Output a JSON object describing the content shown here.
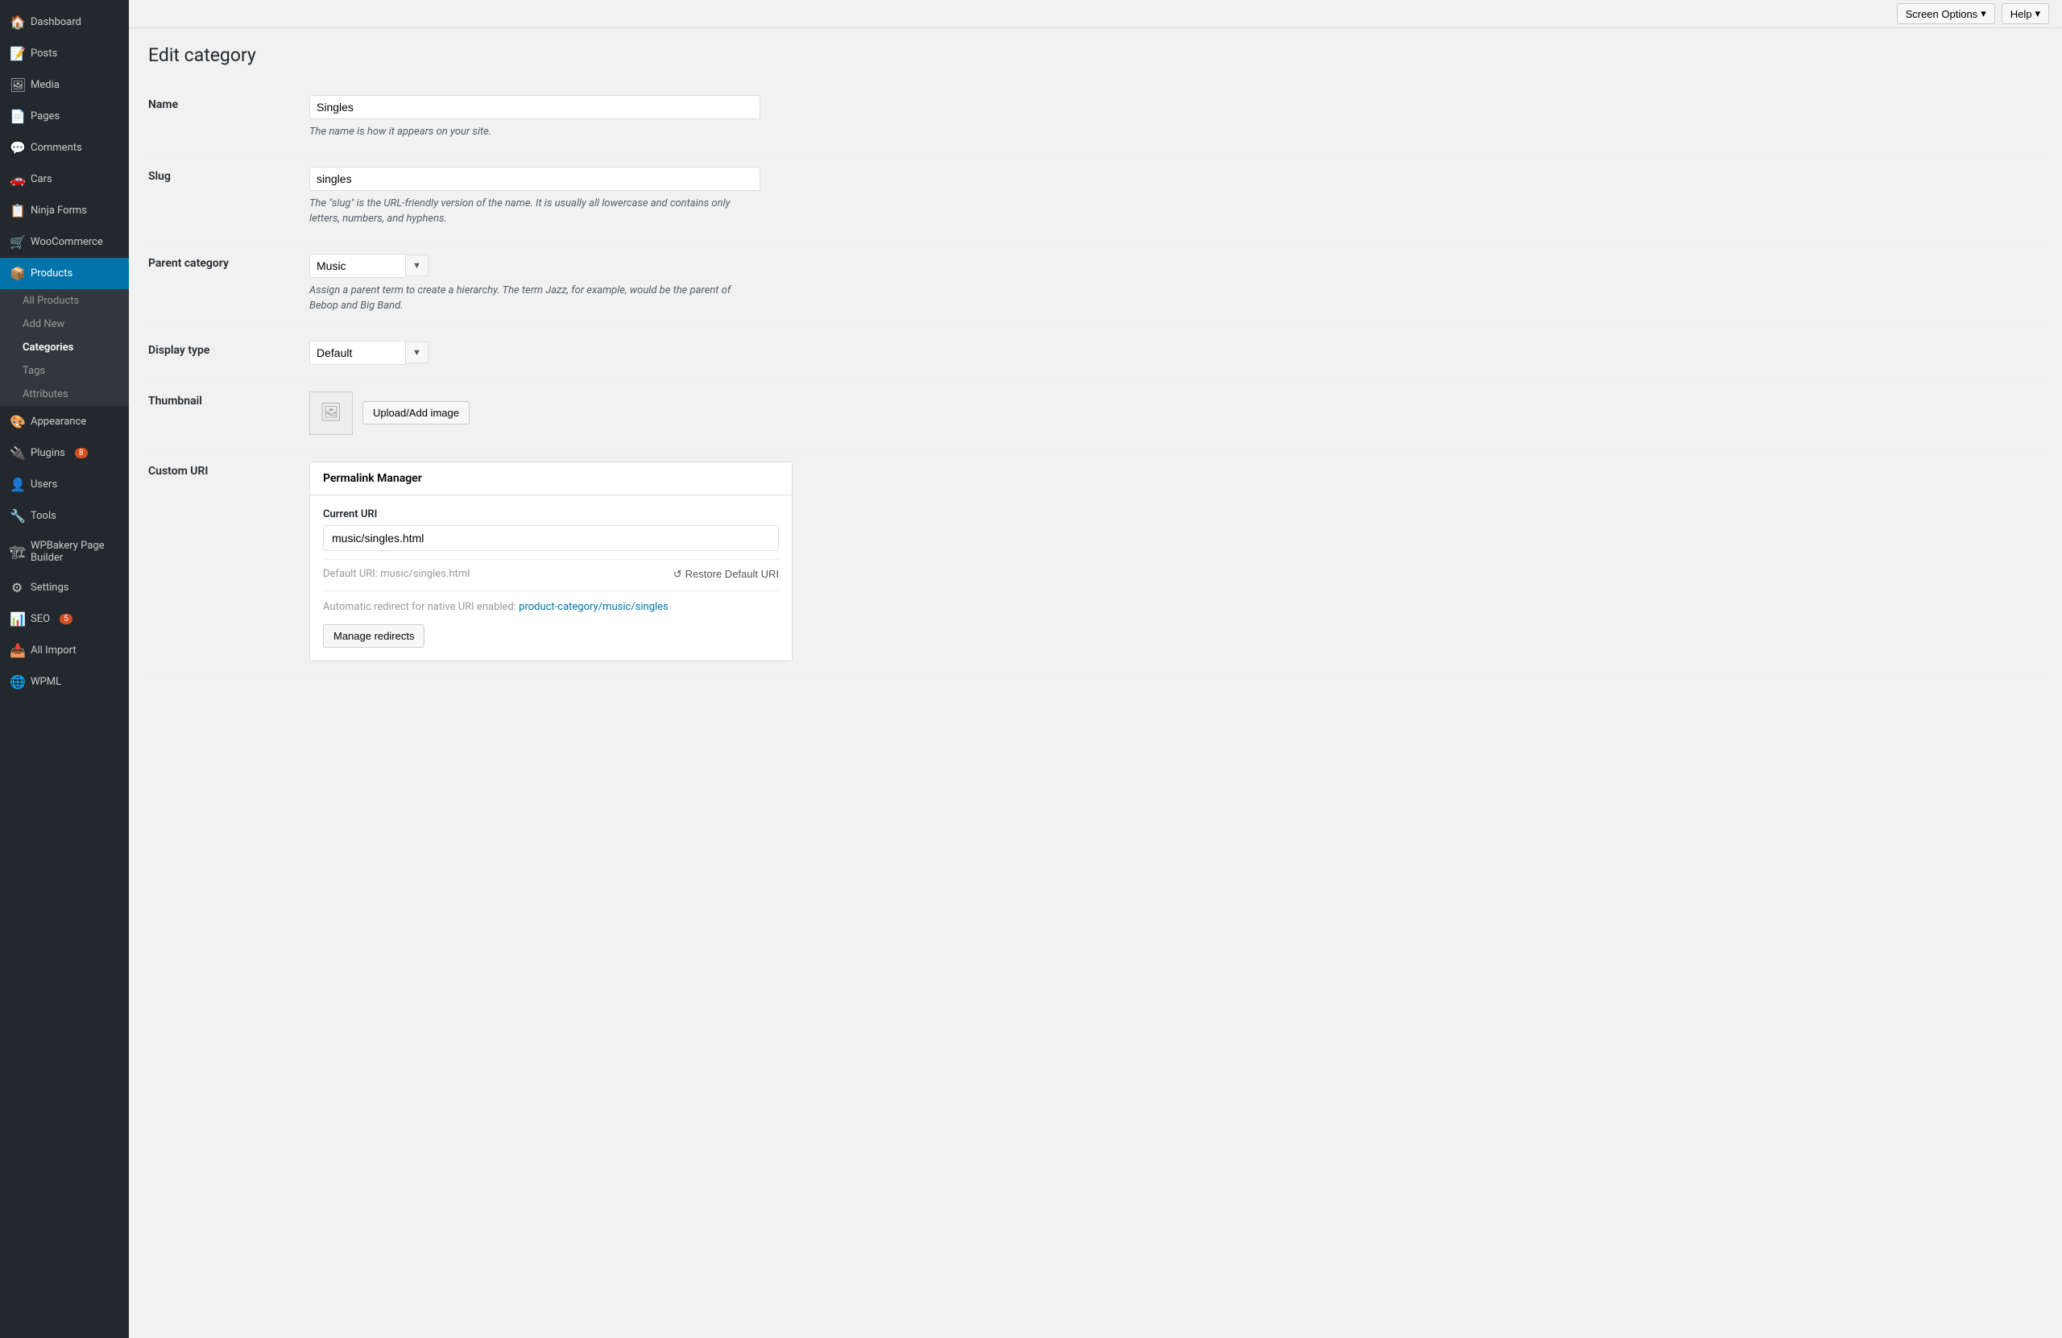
{
  "sidebar": {
    "items": [
      {
        "id": "dashboard",
        "label": "Dashboard",
        "icon": "🏠"
      },
      {
        "id": "posts",
        "label": "Posts",
        "icon": "📝"
      },
      {
        "id": "media",
        "label": "Media",
        "icon": "🖼"
      },
      {
        "id": "pages",
        "label": "Pages",
        "icon": "📄"
      },
      {
        "id": "comments",
        "label": "Comments",
        "icon": "💬"
      },
      {
        "id": "cars",
        "label": "Cars",
        "icon": "🚗"
      },
      {
        "id": "ninja-forms",
        "label": "Ninja Forms",
        "icon": "📋"
      },
      {
        "id": "woocommerce",
        "label": "WooCommerce",
        "icon": "🛒"
      },
      {
        "id": "products",
        "label": "Products",
        "icon": "📦"
      }
    ],
    "products_submenu": [
      {
        "id": "all-products",
        "label": "All Products"
      },
      {
        "id": "add-new",
        "label": "Add New"
      },
      {
        "id": "categories",
        "label": "Categories"
      },
      {
        "id": "tags",
        "label": "Tags"
      },
      {
        "id": "attributes",
        "label": "Attributes"
      }
    ],
    "bottom_items": [
      {
        "id": "appearance",
        "label": "Appearance",
        "icon": "🎨"
      },
      {
        "id": "plugins",
        "label": "Plugins",
        "icon": "🔌",
        "badge": "8"
      },
      {
        "id": "users",
        "label": "Users",
        "icon": "👤"
      },
      {
        "id": "tools",
        "label": "Tools",
        "icon": "🔧"
      },
      {
        "id": "wpbakery",
        "label": "WPBakery Page Builder",
        "icon": "🏗"
      },
      {
        "id": "settings",
        "label": "Settings",
        "icon": "⚙"
      },
      {
        "id": "seo",
        "label": "SEO",
        "icon": "📊",
        "badge": "5"
      },
      {
        "id": "all-import",
        "label": "All Import",
        "icon": "📥"
      },
      {
        "id": "wpml",
        "label": "WPML",
        "icon": "🌐"
      }
    ]
  },
  "topbar": {
    "screen_options_label": "Screen Options",
    "help_label": "Help"
  },
  "page": {
    "title": "Edit category"
  },
  "form": {
    "name_label": "Name",
    "name_value": "Singles",
    "name_description": "The name is how it appears on your site.",
    "slug_label": "Slug",
    "slug_value": "singles",
    "slug_description": "The \"slug\" is the URL-friendly version of the name. It is usually all lowercase and contains only letters, numbers, and hyphens.",
    "parent_label": "Parent category",
    "parent_value": "Music",
    "parent_description": "Assign a parent term to create a hierarchy. The term Jazz, for example, would be the parent of Bebop and Big Band.",
    "display_label": "Display type",
    "display_value": "Default",
    "thumbnail_label": "Thumbnail",
    "upload_btn_label": "Upload/Add image",
    "custom_uri_label": "Custom URI"
  },
  "permalink_manager": {
    "box_title": "Permalink Manager",
    "current_uri_label": "Current URI",
    "current_uri_value": "music/singles.html",
    "default_uri_label": "Default URI:",
    "default_uri_value": "music/singles.html",
    "restore_label": "Restore Default URI",
    "redirect_label": "Automatic redirect for native URI enabled:",
    "redirect_link_text": "product-category/music/singles",
    "manage_btn_label": "Manage redirects"
  }
}
